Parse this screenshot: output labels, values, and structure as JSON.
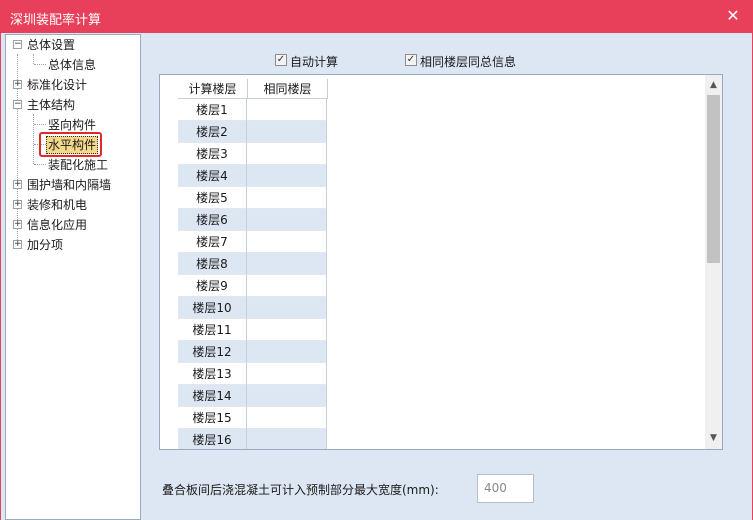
{
  "window": {
    "title": "深圳装配率计算",
    "close_glyph": "✕"
  },
  "tree": {
    "items": [
      {
        "label": "总体设置",
        "toggle": "−"
      },
      {
        "label": "总体信息"
      },
      {
        "label": "标准化设计",
        "toggle": "+"
      },
      {
        "label": "主体结构",
        "toggle": "−"
      },
      {
        "label": "竖向构件"
      },
      {
        "label": "水平构件",
        "selected": true
      },
      {
        "label": "装配化施工"
      },
      {
        "label": "围护墙和内隔墙",
        "toggle": "+"
      },
      {
        "label": "装修和机电",
        "toggle": "+"
      },
      {
        "label": "信息化应用",
        "toggle": "+"
      },
      {
        "label": "加分项",
        "toggle": "+"
      }
    ]
  },
  "options": {
    "auto_calc": {
      "label": "自动计算",
      "checked": true
    },
    "same_floor_summary": {
      "label": "相同楼层同总信息",
      "checked": true
    }
  },
  "grid": {
    "columns": [
      "计算楼层",
      "相同楼层"
    ],
    "rows": [
      "楼层1",
      "楼层2",
      "楼层3",
      "楼层4",
      "楼层5",
      "楼层6",
      "楼层7",
      "楼层8",
      "楼层9",
      "楼层10",
      "楼层11",
      "楼层12",
      "楼层13",
      "楼层14",
      "楼层15",
      "楼层16"
    ],
    "scroll_up_glyph": "▲",
    "scroll_down_glyph": "▼"
  },
  "bottom": {
    "label": "叠合板间后浇混凝土可计入预制部分最大宽度(mm):",
    "width_value": "400"
  },
  "colors": {
    "titlebar": "#e8405a",
    "panel_bg": "#dde7f3",
    "highlight": "#e02a2a"
  }
}
